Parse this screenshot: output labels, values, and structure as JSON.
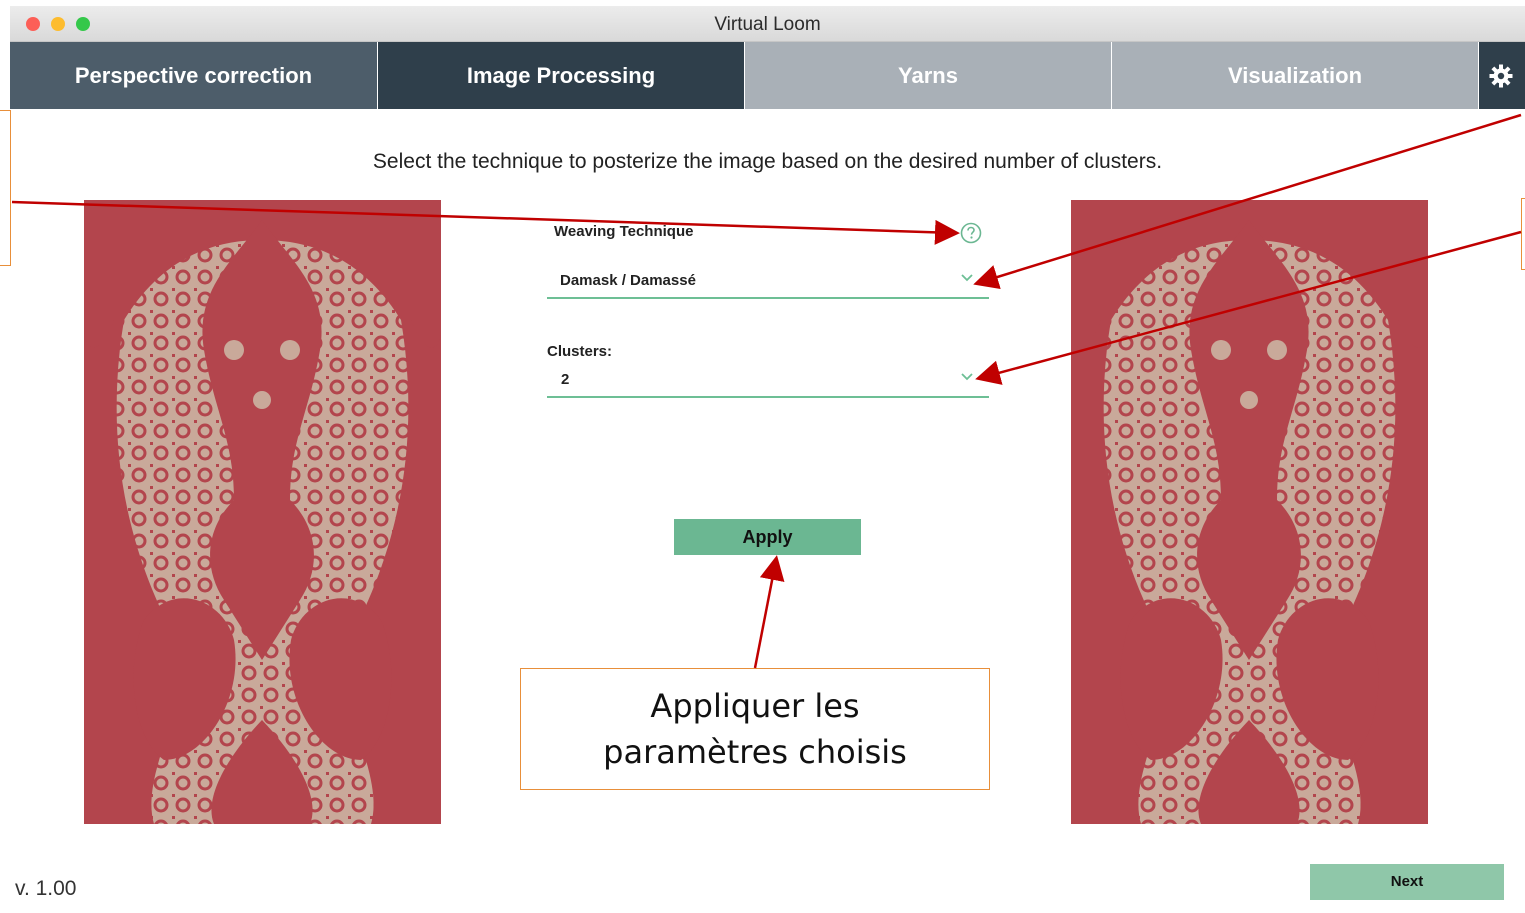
{
  "window": {
    "title": "Virtual Loom"
  },
  "tabs": [
    {
      "label": "Perspective correction",
      "state": "inactive"
    },
    {
      "label": "Image Processing",
      "state": "active"
    },
    {
      "label": "Yarns",
      "state": "disabled"
    },
    {
      "label": "Visualization",
      "state": "disabled"
    }
  ],
  "settings_icon": "gear-icon",
  "instruction": "Select the technique to posterize the image based on the desired number of clusters.",
  "weaving": {
    "label": "Weaving Technique",
    "value": "Damask / Damassé",
    "help_icon": "question-circle-icon"
  },
  "clusters": {
    "label": "Clusters:",
    "value": "2"
  },
  "apply_label": "Apply",
  "next_label": "Next",
  "version": "v. 1.00",
  "callout": {
    "line1": "Appliquer les",
    "line2": "paramètres choisis"
  },
  "colors": {
    "tab_active": "#2f3f4b",
    "tab_inactive": "#4d5d6a",
    "tab_disabled": "#a9b0b7",
    "accent": "#6bb792",
    "fabric_red": "#b3454d",
    "fabric_beige": "#c9a99a",
    "annotation_arrow": "#c00000",
    "callout_border": "#e88f3a"
  }
}
